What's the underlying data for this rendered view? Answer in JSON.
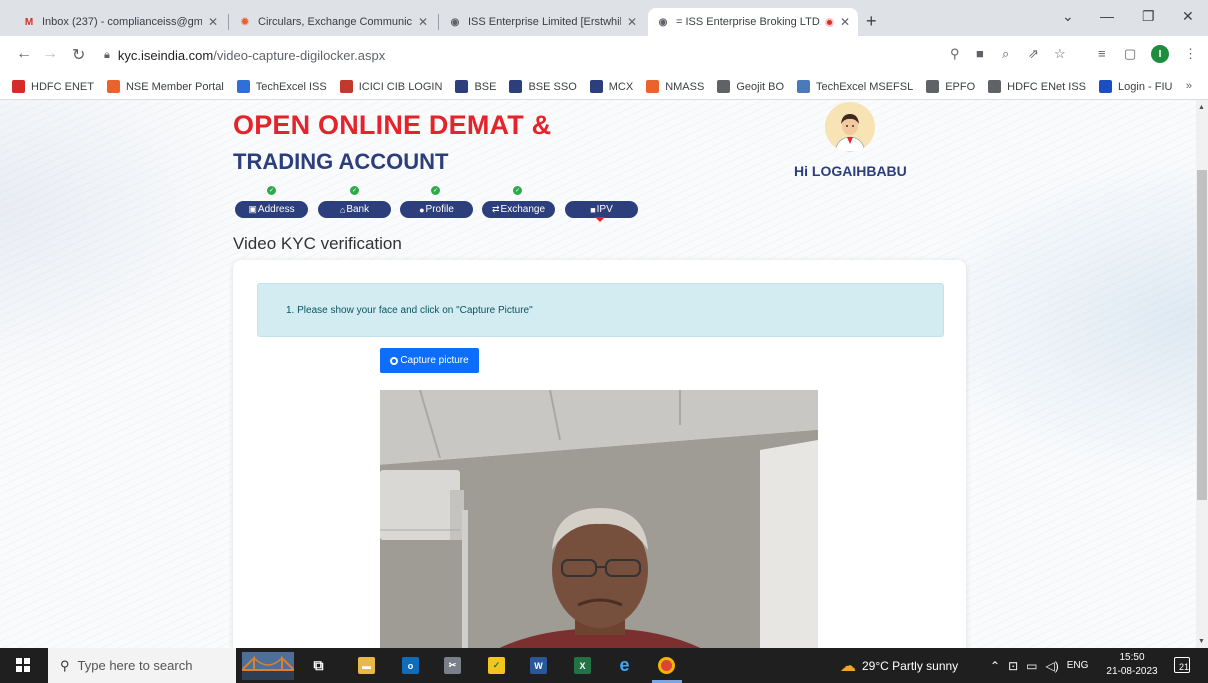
{
  "browser": {
    "tabs": [
      {
        "title": "Inbox (237) - complianceiss@gm",
        "favicon": "gmail-icon",
        "active": false
      },
      {
        "title": "Circulars, Exchange Communicat",
        "favicon": "nse-icon",
        "active": false
      },
      {
        "title": "ISS Enterprise Limited [Erstwhile",
        "favicon": "globe-icon",
        "active": false
      },
      {
        "title": "= ISS Enterprise Broking LTD.",
        "favicon": "globe-icon",
        "active": true
      }
    ],
    "new_tab": "+",
    "window_controls": {
      "minimize": "—",
      "restore": "❐",
      "close": "✕",
      "tab_search": "⌄"
    },
    "url_host": "kyc.iseindia.com",
    "url_path": "/video-capture-digilocker.aspx",
    "profile_initial": "I",
    "bookmarks": [
      {
        "label": "HDFC ENET",
        "color": "#d62b2b"
      },
      {
        "label": "NSE Member Portal",
        "color": "#e8642c"
      },
      {
        "label": "TechExcel ISS",
        "color": "#2f6fd6"
      },
      {
        "label": "ICICI CIB LOGIN",
        "color": "#c0392b"
      },
      {
        "label": "BSE",
        "color": "#2c3f7c"
      },
      {
        "label": "BSE SSO",
        "color": "#2c3f7c"
      },
      {
        "label": "MCX",
        "color": "#2c3f7c"
      },
      {
        "label": "NMASS",
        "color": "#e8642c"
      },
      {
        "label": "Geojit BO",
        "color": "#5f6368"
      },
      {
        "label": "TechExcel MSEFSL",
        "color": "#4a7ab8"
      },
      {
        "label": "EPFO",
        "color": "#5f6368"
      },
      {
        "label": "HDFC ENet ISS",
        "color": "#5f6368"
      },
      {
        "label": "Login - FIU",
        "color": "#1a4fc4"
      }
    ],
    "bookmarks_more": "»"
  },
  "page": {
    "heading_line1": "OPEN ONLINE DEMAT &",
    "heading_line2": "TRADING ACCOUNT",
    "greeting": "Hi LOGAIHBABU",
    "steps": [
      {
        "label": "Address",
        "icon": "id-card-icon",
        "done": true
      },
      {
        "label": "Bank",
        "icon": "bank-icon",
        "done": true
      },
      {
        "label": "Profile",
        "icon": "user-icon",
        "done": true
      },
      {
        "label": "Exchange",
        "icon": "shuffle-icon",
        "done": true
      },
      {
        "label": "IPV",
        "icon": "video-icon",
        "done": false
      }
    ],
    "section_title": "Video KYC verification",
    "instruction": "1. Please show your face and click on \"Capture Picture\"",
    "capture_button": "Capture picture"
  },
  "taskbar": {
    "search_placeholder": "Type here to search",
    "weather": "29°C  Partly sunny",
    "language": "ENG",
    "time": "15:50",
    "date": "21-08-2023",
    "notifications": "21"
  },
  "colors": {
    "brand_red": "#e4232b",
    "brand_navy": "#2c3f7c",
    "alert_bg": "#d2ecf1",
    "button_blue": "#0d6efd",
    "check_green": "#2eaa4a"
  }
}
